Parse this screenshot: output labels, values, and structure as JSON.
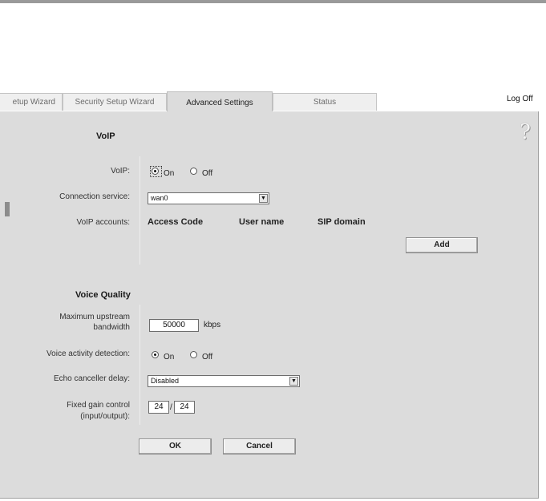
{
  "tabs": [
    {
      "label": "etup Wizard",
      "active": false
    },
    {
      "label": "Security Setup Wizard",
      "active": false
    },
    {
      "label": "Advanced Settings",
      "active": true
    },
    {
      "label": "Status",
      "active": false
    }
  ],
  "logoff": "Log Off",
  "help_icon": "?",
  "voip": {
    "heading": "VoIP",
    "voip_label": "VoIP:",
    "voip_on": "On",
    "voip_off": "Off",
    "voip_selected": "On",
    "connection_label": "Connection service:",
    "connection_value": "wan0",
    "accounts_label": "VoIP accounts:",
    "columns": [
      "Access Code",
      "User name",
      "SIP domain"
    ],
    "add_button": "Add"
  },
  "voice_quality": {
    "heading": "Voice Quality",
    "upstream_label_1": "Maximum upstream",
    "upstream_label_2": "bandwidth",
    "upstream_value": "50000",
    "upstream_unit": "kbps",
    "vad_label": "Voice activity detection:",
    "vad_on": "On",
    "vad_off": "Off",
    "vad_selected": "On",
    "echo_label": "Echo canceller delay:",
    "echo_value": "Disabled",
    "gain_label_1": "Fixed gain control",
    "gain_label_2": "(input/output):",
    "gain_input": "24",
    "gain_separator": "/",
    "gain_output": "24"
  },
  "buttons": {
    "ok": "OK",
    "cancel": "Cancel"
  }
}
